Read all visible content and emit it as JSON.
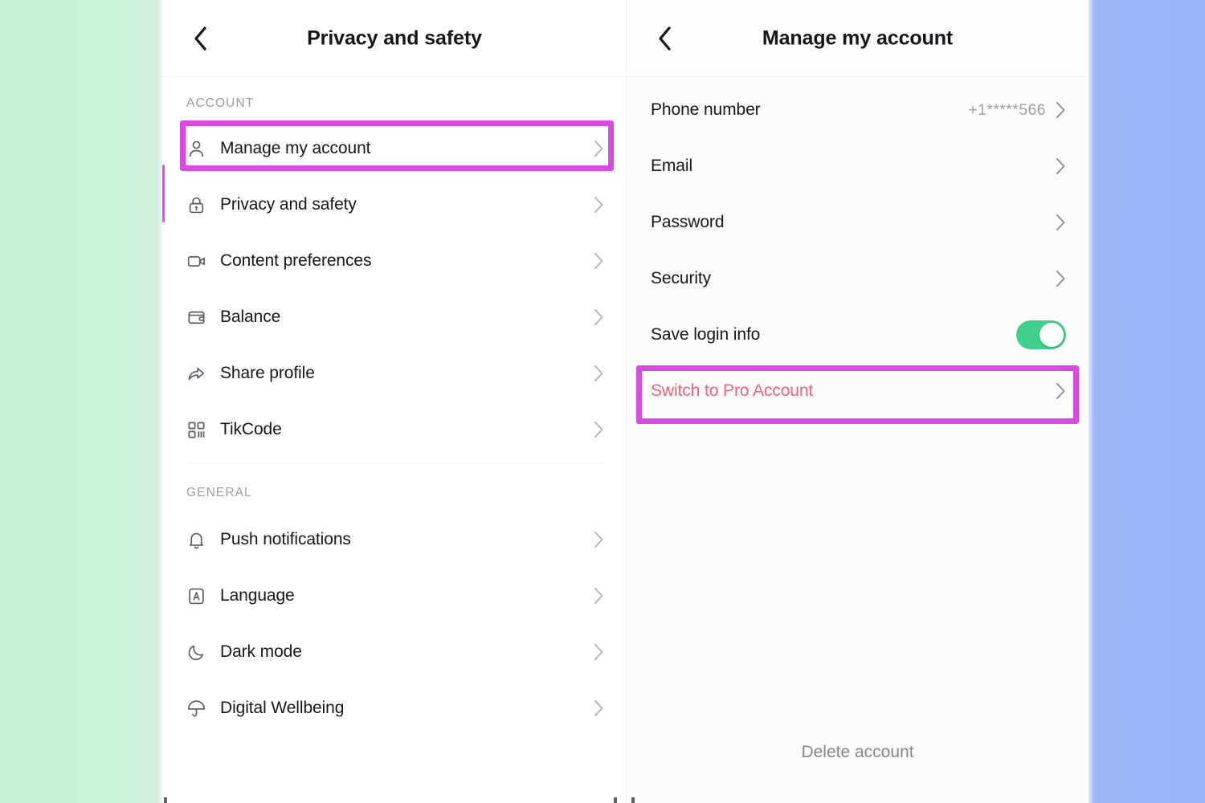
{
  "background": {
    "left_color": "#c6f3d4",
    "right_color": "#9ab6f8"
  },
  "accents": {
    "highlight_border": "#d94ae0",
    "toggle_on": "#3ed08c",
    "danger_text": "#f0637a",
    "scroll_bar": "#c06bd0"
  },
  "left_panel": {
    "header": {
      "back_icon": "chevron-left-icon",
      "title": "Privacy and safety"
    },
    "sections": [
      {
        "label": "ACCOUNT",
        "items": [
          {
            "icon": "person-icon",
            "label": "Manage my account",
            "accessory": "chevron-right-icon",
            "highlighted": true
          },
          {
            "icon": "lock-icon",
            "label": "Privacy and safety",
            "accessory": "chevron-right-icon",
            "highlighted": false
          },
          {
            "icon": "video-camera-icon",
            "label": "Content preferences",
            "accessory": "chevron-right-icon",
            "highlighted": false
          },
          {
            "icon": "wallet-icon",
            "label": "Balance",
            "accessory": "chevron-right-icon",
            "highlighted": false
          },
          {
            "icon": "share-arrow-icon",
            "label": "Share profile",
            "accessory": "chevron-right-icon",
            "highlighted": false
          },
          {
            "icon": "qr-code-icon",
            "label": "TikCode",
            "accessory": "chevron-right-icon",
            "highlighted": false
          }
        ]
      },
      {
        "label": "GENERAL",
        "items": [
          {
            "icon": "bell-icon",
            "label": "Push notifications",
            "accessory": "chevron-right-icon",
            "highlighted": false
          },
          {
            "icon": "language-a-icon",
            "label": "Language",
            "accessory": "chevron-right-icon",
            "highlighted": false
          },
          {
            "icon": "moon-icon",
            "label": "Dark mode",
            "accessory": "chevron-right-icon",
            "highlighted": false
          },
          {
            "icon": "umbrella-icon",
            "label": "Digital Wellbeing",
            "accessory": "chevron-right-icon",
            "highlighted": false
          }
        ]
      }
    ]
  },
  "right_panel": {
    "header": {
      "back_icon": "chevron-left-icon",
      "title": "Manage my account"
    },
    "items": [
      {
        "label": "Phone number",
        "value": "+1*****566",
        "accessory": "chevron-right-icon",
        "danger": false,
        "highlighted": false
      },
      {
        "label": "Email",
        "value": "",
        "accessory": "chevron-right-icon",
        "danger": false,
        "highlighted": false
      },
      {
        "label": "Password",
        "value": "",
        "accessory": "chevron-right-icon",
        "danger": false,
        "highlighted": false
      },
      {
        "label": "Security",
        "value": "",
        "accessory": "chevron-right-icon",
        "danger": false,
        "highlighted": false
      },
      {
        "label": "Save login info",
        "value": "",
        "accessory": "toggle-on",
        "danger": false,
        "highlighted": false
      },
      {
        "label": "Switch to Pro Account",
        "value": "",
        "accessory": "chevron-right-icon",
        "danger": true,
        "highlighted": true
      }
    ],
    "footer": {
      "delete_account_label": "Delete account"
    }
  }
}
